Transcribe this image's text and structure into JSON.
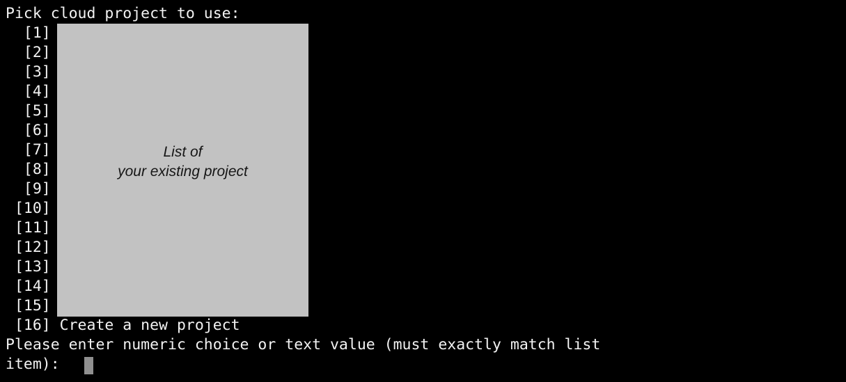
{
  "terminal": {
    "background_color": "#000000",
    "text_color": "#f2f2f2",
    "prompt_header": "Pick cloud project to use:",
    "menu_items": [
      {
        "index": "1",
        "line": "  [1]"
      },
      {
        "index": "2",
        "line": "  [2]"
      },
      {
        "index": "3",
        "line": "  [3]"
      },
      {
        "index": "4",
        "line": "  [4]"
      },
      {
        "index": "5",
        "line": "  [5]"
      },
      {
        "index": "6",
        "line": "  [6]"
      },
      {
        "index": "7",
        "line": "  [7]"
      },
      {
        "index": "8",
        "line": "  [8]"
      },
      {
        "index": "9",
        "line": "  [9]"
      },
      {
        "index": "10",
        "line": " [10]"
      },
      {
        "index": "11",
        "line": " [11]"
      },
      {
        "index": "12",
        "line": " [12]"
      },
      {
        "index": "13",
        "line": " [13]"
      },
      {
        "index": "14",
        "line": " [14]"
      },
      {
        "index": "15",
        "line": " [15]"
      },
      {
        "index": "16",
        "line": " [16] Create a new project"
      }
    ],
    "prompt_line_1": "Please enter numeric choice or text value (must exactly match list",
    "prompt_line_2": "item): ",
    "cursor": {
      "color": "#909090",
      "shape": "block"
    }
  },
  "redaction": {
    "color": "#c2c2c2",
    "note_line_1": "List of",
    "note_line_2": "your existing project",
    "note_text": "List of\nyour existing project",
    "note_color": "#161616"
  }
}
